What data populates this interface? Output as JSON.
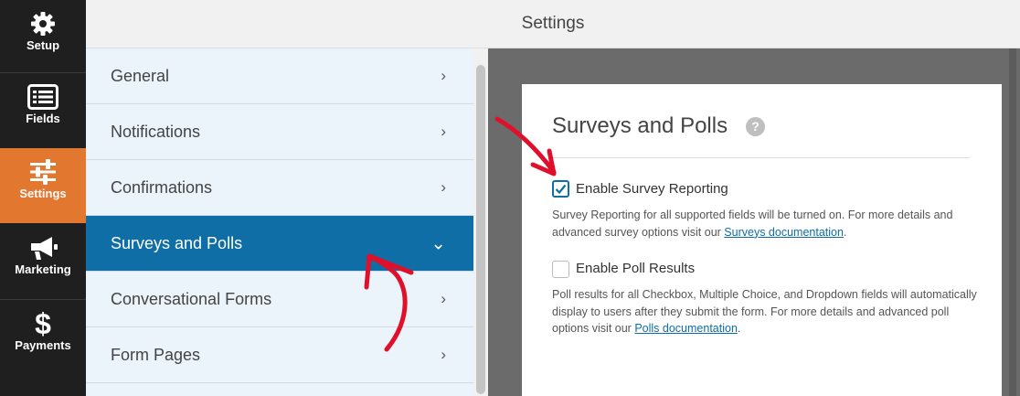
{
  "nav": {
    "items": [
      {
        "label": "Setup",
        "icon": "gear-icon",
        "active": false
      },
      {
        "label": "Fields",
        "icon": "form-fields-icon",
        "active": false
      },
      {
        "label": "Settings",
        "icon": "sliders-icon",
        "active": true
      },
      {
        "label": "Marketing",
        "icon": "megaphone-icon",
        "active": false
      },
      {
        "label": "Payments",
        "icon": "dollar-icon",
        "active": false
      }
    ],
    "active_color": "#e27730"
  },
  "header": {
    "title": "Settings"
  },
  "settings_panel": {
    "items": [
      {
        "label": "General",
        "chevron": "›"
      },
      {
        "label": "Notifications",
        "chevron": "›"
      },
      {
        "label": "Confirmations",
        "chevron": "›"
      },
      {
        "label": "Surveys and Polls",
        "chevron": "⌄",
        "active": true
      },
      {
        "label": "Conversational Forms",
        "chevron": "›"
      },
      {
        "label": "Form Pages",
        "chevron": "›"
      }
    ],
    "active_color": "#0e6ea5"
  },
  "card": {
    "title": "Surveys and Polls",
    "help_glyph": "?",
    "survey": {
      "label": "Enable Survey Reporting",
      "checked": true,
      "desc_before": "Survey Reporting for all supported fields will be turned on. For more details and advanced survey options visit our ",
      "link": "Surveys documentation",
      "desc_after": "."
    },
    "poll": {
      "label": "Enable Poll Results",
      "checked": false,
      "desc_before": "Poll results for all Checkbox, Multiple Choice, and Dropdown fields will automatically display to users after they submit the form. For more details and advanced poll options visit our ",
      "link": "Polls documentation",
      "desc_after": "."
    }
  },
  "annotation_color": "#e0102a"
}
